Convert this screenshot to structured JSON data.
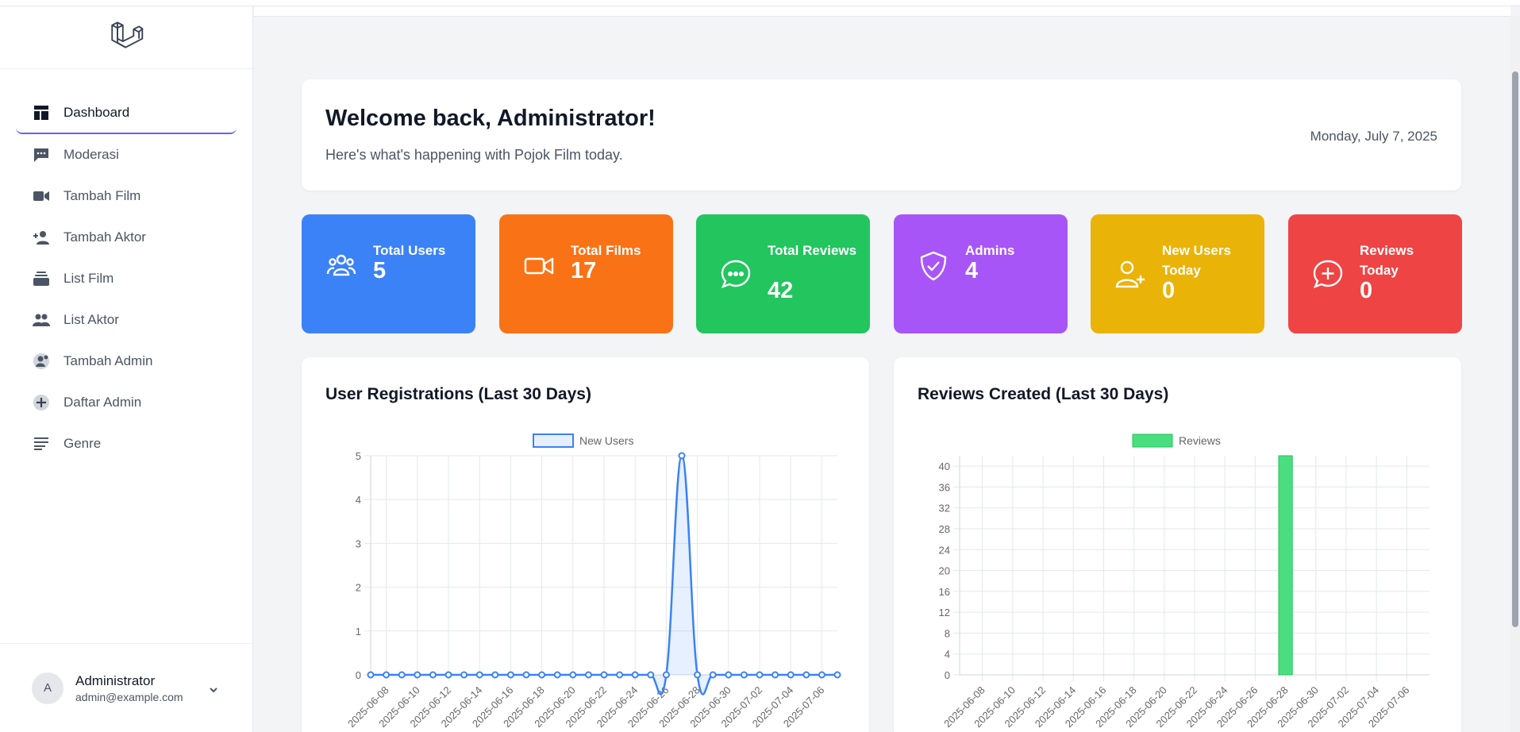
{
  "sidebar": {
    "items": [
      {
        "label": "Dashboard",
        "icon": "dashboard-icon",
        "active": true
      },
      {
        "label": "Moderasi",
        "icon": "chat-icon"
      },
      {
        "label": "Tambah Film",
        "icon": "video-camera-icon"
      },
      {
        "label": "Tambah Aktor",
        "icon": "person-add-icon"
      },
      {
        "label": "List Film",
        "icon": "stack-icon"
      },
      {
        "label": "List Aktor",
        "icon": "people-icon"
      },
      {
        "label": "Tambah Admin",
        "icon": "admin-user-icon"
      },
      {
        "label": "Daftar Admin",
        "icon": "plus-circle-icon"
      },
      {
        "label": "Genre",
        "icon": "list-lines-icon"
      }
    ],
    "user": {
      "initial": "A",
      "name": "Administrator",
      "email": "admin@example.com"
    }
  },
  "welcome": {
    "title": "Welcome back, Administrator!",
    "subtitle": "Here's what's happening with Pojok Film today.",
    "date": "Monday, July 7, 2025"
  },
  "stats": [
    {
      "label": "Total Users",
      "value": "5",
      "color": "#3b82f6",
      "icon": "users-icon"
    },
    {
      "label": "Total Films",
      "value": "17",
      "color": "#f97316",
      "icon": "video-icon"
    },
    {
      "label": "Total Reviews",
      "value": "42",
      "color": "#22c55e",
      "icon": "chat-bubble-icon"
    },
    {
      "label": "Admins",
      "value": "4",
      "color": "#a855f7",
      "icon": "shield-check-icon"
    },
    {
      "label": "New Users Today",
      "value": "0",
      "color": "#eab308",
      "icon": "user-plus-icon"
    },
    {
      "label": "Reviews Today",
      "value": "0",
      "color": "#ef4444",
      "icon": "plus-bubble-icon"
    }
  ],
  "chart_data": [
    {
      "type": "line",
      "title": "User Registrations (Last 30 Days)",
      "x_tick_labels": [
        "2025-06-08",
        "2025-06-10",
        "2025-06-12",
        "2025-06-14",
        "2025-06-16",
        "2025-06-18",
        "2025-06-20",
        "2025-06-22",
        "2025-06-24",
        "2025-06-26",
        "2025-06-28",
        "2025-06-30",
        "2025-07-02",
        "2025-07-04",
        "2025-07-06"
      ],
      "x": [
        "2025-06-07",
        "2025-06-08",
        "2025-06-09",
        "2025-06-10",
        "2025-06-11",
        "2025-06-12",
        "2025-06-13",
        "2025-06-14",
        "2025-06-15",
        "2025-06-16",
        "2025-06-17",
        "2025-06-18",
        "2025-06-19",
        "2025-06-20",
        "2025-06-21",
        "2025-06-22",
        "2025-06-23",
        "2025-06-24",
        "2025-06-25",
        "2025-06-26",
        "2025-06-27",
        "2025-06-28",
        "2025-06-29",
        "2025-06-30",
        "2025-07-01",
        "2025-07-02",
        "2025-07-03",
        "2025-07-04",
        "2025-07-05",
        "2025-07-06",
        "2025-07-07"
      ],
      "series": [
        {
          "name": "New Users",
          "values": [
            0,
            0,
            0,
            0,
            0,
            0,
            0,
            0,
            0,
            0,
            0,
            0,
            0,
            0,
            0,
            0,
            0,
            0,
            0,
            0,
            5,
            0,
            0,
            0,
            0,
            0,
            0,
            0,
            0,
            0,
            0
          ],
          "color": "#3b82f6"
        }
      ],
      "ylim": [
        0,
        5
      ],
      "yticks": [
        0,
        1,
        2,
        3,
        4,
        5
      ],
      "grid": true,
      "legend": "top"
    },
    {
      "type": "bar",
      "title": "Reviews Created (Last 30 Days)",
      "x_tick_labels": [
        "2025-06-08",
        "2025-06-10",
        "2025-06-12",
        "2025-06-14",
        "2025-06-16",
        "2025-06-18",
        "2025-06-20",
        "2025-06-22",
        "2025-06-24",
        "2025-06-26",
        "2025-06-28",
        "2025-06-30",
        "2025-07-02",
        "2025-07-04",
        "2025-07-06"
      ],
      "x": [
        "2025-06-07",
        "2025-06-08",
        "2025-06-09",
        "2025-06-10",
        "2025-06-11",
        "2025-06-12",
        "2025-06-13",
        "2025-06-14",
        "2025-06-15",
        "2025-06-16",
        "2025-06-17",
        "2025-06-18",
        "2025-06-19",
        "2025-06-20",
        "2025-06-21",
        "2025-06-22",
        "2025-06-23",
        "2025-06-24",
        "2025-06-25",
        "2025-06-26",
        "2025-06-27",
        "2025-06-28",
        "2025-06-29",
        "2025-06-30",
        "2025-07-01",
        "2025-07-02",
        "2025-07-03",
        "2025-07-04",
        "2025-07-05",
        "2025-07-06",
        "2025-07-07"
      ],
      "series": [
        {
          "name": "Reviews",
          "values": [
            0,
            0,
            0,
            0,
            0,
            0,
            0,
            0,
            0,
            0,
            0,
            0,
            0,
            0,
            0,
            0,
            0,
            0,
            0,
            0,
            0,
            42,
            0,
            0,
            0,
            0,
            0,
            0,
            0,
            0,
            0
          ],
          "color": "#4ade80"
        }
      ],
      "ylim": [
        0,
        42
      ],
      "yticks": [
        0,
        4,
        8,
        12,
        16,
        20,
        24,
        28,
        32,
        36,
        40
      ],
      "grid": true,
      "legend": "top"
    }
  ]
}
